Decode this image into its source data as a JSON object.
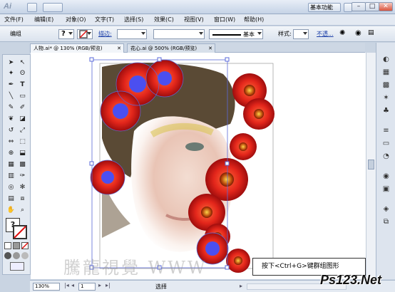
{
  "app": {
    "name": "Ai",
    "workspace": "基本功能",
    "window_controls": [
      "–",
      "□",
      "✕"
    ]
  },
  "menu": [
    "文件(F)",
    "编辑(E)",
    "对象(O)",
    "文字(T)",
    "选择(S)",
    "效果(C)",
    "视图(V)",
    "窗口(W)",
    "帮助(H)"
  ],
  "control_bar": {
    "selection_label": "编组",
    "stroke_label": "描边:",
    "stroke_style": "基本",
    "style_label": "样式:",
    "opacity_label": "不透..."
  },
  "tabs": [
    {
      "label": "人物.ai* @ 130% (RGB/预览)",
      "active": true
    },
    {
      "label": "花心.ai @ 500% (RGB/预览)",
      "active": false
    }
  ],
  "status": {
    "zoom": "130%",
    "page": "1",
    "mode": "选择"
  },
  "tooltip": "按下<Ctrl+G>键群组图形",
  "watermark": "騰龍視覺 WWW",
  "brand": "Ps123.Net",
  "colors": {
    "flower_red": "#e0241b",
    "flower_blue": "#4b4ff0",
    "selection": "#5a6ad8"
  }
}
